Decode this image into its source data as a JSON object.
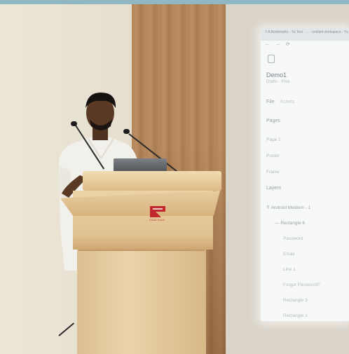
{
  "scene": {
    "podium_logo_text": "CDAC Kochi"
  },
  "projected_screen": {
    "titlebar_text": "Y.A Bookmarks · Ya Test · ... · untitled workspace · Ya",
    "toolbar_icons": [
      "back-icon",
      "forward-icon",
      "reload-icon"
    ],
    "file_name": "Demo1",
    "file_subtitle": "Drafts · Free",
    "file_label": "File",
    "file_value": "Assets",
    "pages_label": "Pages",
    "pages": [
      "Page 1",
      "Poster",
      "Frame"
    ],
    "layers_label": "Layers",
    "layers": [
      {
        "label": "Android Medium - 1",
        "level": 1
      },
      {
        "label": "Rectangle 6",
        "level": 2
      },
      {
        "label": "Password",
        "level": 3
      },
      {
        "label": "Email",
        "level": 3
      },
      {
        "label": "Line 1",
        "level": 3
      },
      {
        "label": "Forgot Password?",
        "level": 3
      },
      {
        "label": "Rectangle 3",
        "level": 3
      },
      {
        "label": "Rectangle 1",
        "level": 3
      }
    ]
  },
  "colors": {
    "wood": "#b4865a",
    "podium": "#e4c796",
    "logo_red": "#c0282d",
    "shirt": "#f3f1ec",
    "skin": "#5a3a24"
  }
}
